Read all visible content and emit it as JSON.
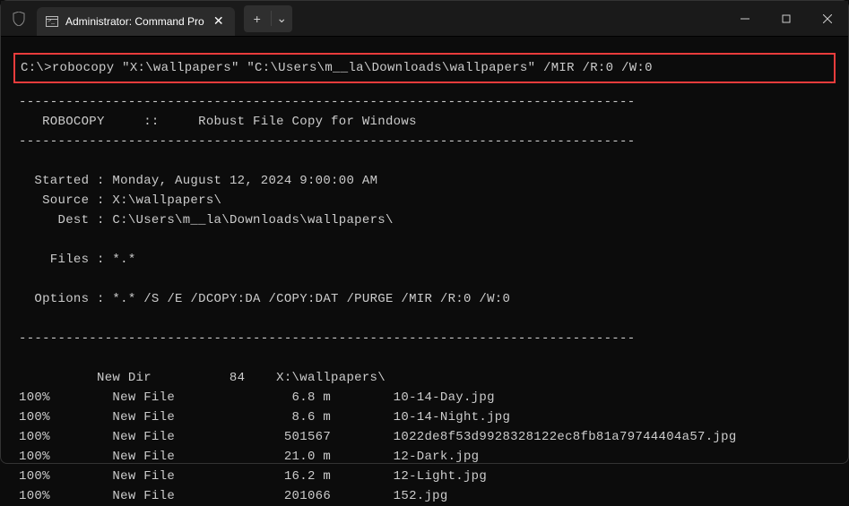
{
  "titlebar": {
    "tab_title": "Administrator: Command Pro",
    "close_glyph": "✕",
    "plus_glyph": "+",
    "chevron_glyph": "⌄"
  },
  "terminal": {
    "prompt": "C:\\>",
    "command": "robocopy \"X:\\wallpapers\" \"C:\\Users\\m__la\\Downloads\\wallpapers\" /MIR /R:0 /W:0",
    "divider": "-------------------------------------------------------------------------------",
    "banner": "   ROBOCOPY     ::     Robust File Copy for Windows",
    "meta": {
      "started_label": "  Started : ",
      "started_value": "Monday, August 12, 2024 9:00:00 AM",
      "source_label": "   Source : ",
      "source_value": "X:\\wallpapers\\",
      "dest_label": "     Dest : ",
      "dest_value": "C:\\Users\\m__la\\Downloads\\wallpapers\\",
      "files_label": "    Files : ",
      "files_value": "*.*",
      "options_label": "  Options : ",
      "options_value": "*.* /S /E /DCOPY:DA /COPY:DAT /PURGE /MIR /R:0 /W:0"
    },
    "dir_row": "          New Dir          84    X:\\wallpapers\\",
    "files": [
      "100%        New File               6.8 m        10-14-Day.jpg",
      "100%        New File               8.6 m        10-14-Night.jpg",
      "100%        New File              501567        1022de8f53d9928328122ec8fb81a79744404a57.jpg",
      "100%        New File              21.0 m        12-Dark.jpg",
      "100%        New File              16.2 m        12-Light.jpg",
      "100%        New File              201066        152.jpg"
    ]
  }
}
